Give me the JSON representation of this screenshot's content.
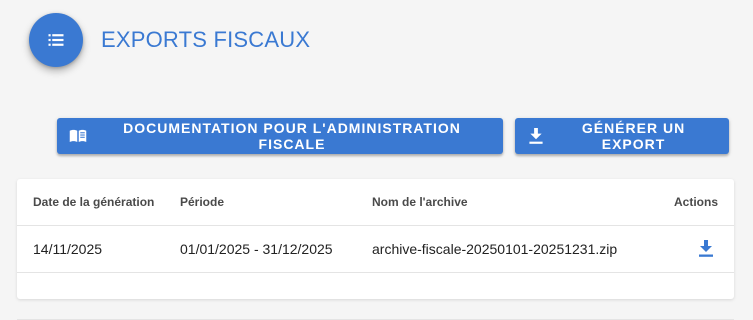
{
  "header": {
    "icon": "list-icon",
    "title": "EXPORTS FISCAUX"
  },
  "toolbar": {
    "doc_button": {
      "icon": "book-icon",
      "label": "DOCUMENTATION POUR L'ADMINISTRATION FISCALE"
    },
    "export_button": {
      "icon": "download-icon",
      "label": "GÉNÉRER UN EXPORT"
    }
  },
  "table": {
    "columns": [
      "Date de la génération",
      "Période",
      "Nom de l'archive",
      "Actions"
    ],
    "rows": [
      {
        "date": "14/11/2025",
        "period": "01/01/2025 - 31/12/2025",
        "archive": "archive-fiscale-20250101-20251231.zip",
        "action_icon": "download-icon"
      }
    ]
  },
  "colors": {
    "primary": "#3a79d2",
    "background": "#f5f5f5",
    "card": "#ffffff"
  }
}
